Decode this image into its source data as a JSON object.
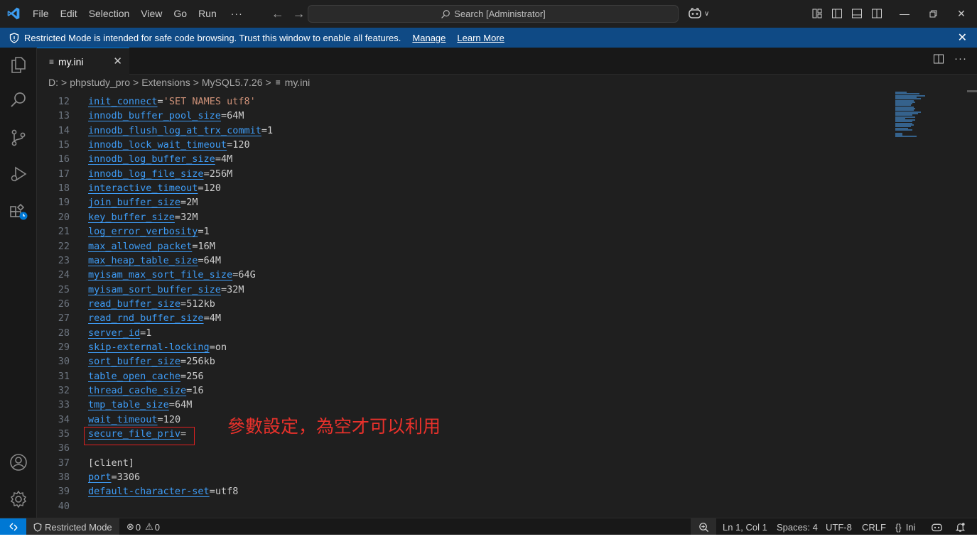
{
  "titlebar": {
    "menu": [
      "File",
      "Edit",
      "Selection",
      "View",
      "Go",
      "Run"
    ],
    "more": "···",
    "search_placeholder": "Search [Administrator]"
  },
  "banner": {
    "message": "Restricted Mode is intended for safe code browsing. Trust this window to enable all features.",
    "manage": "Manage",
    "learn_more": "Learn More",
    "close": "✕"
  },
  "tab": {
    "label": "my.ini",
    "icon": "≡",
    "close": "✕"
  },
  "breadcrumb": {
    "items": [
      "D:",
      "phpstudy_pro",
      "Extensions",
      "MySQL5.7.26",
      "my.ini"
    ],
    "separator": ">",
    "file_icon": "≡"
  },
  "editor": {
    "lines": [
      {
        "n": "12",
        "key": "init_connect",
        "eq": "=",
        "str": "'SET NAMES utf8'"
      },
      {
        "n": "13",
        "key": "innodb_buffer_pool_size",
        "eq": "=",
        "val": "64M"
      },
      {
        "n": "14",
        "key": "innodb_flush_log_at_trx_commit",
        "eq": "=",
        "val": "1"
      },
      {
        "n": "15",
        "key": "innodb_lock_wait_timeout",
        "eq": "=",
        "val": "120"
      },
      {
        "n": "16",
        "key": "innodb_log_buffer_size",
        "eq": "=",
        "val": "4M"
      },
      {
        "n": "17",
        "key": "innodb_log_file_size",
        "eq": "=",
        "val": "256M"
      },
      {
        "n": "18",
        "key": "interactive_timeout",
        "eq": "=",
        "val": "120"
      },
      {
        "n": "19",
        "key": "join_buffer_size",
        "eq": "=",
        "val": "2M"
      },
      {
        "n": "20",
        "key": "key_buffer_size",
        "eq": "=",
        "val": "32M"
      },
      {
        "n": "21",
        "key": "log_error_verbosity",
        "eq": "=",
        "val": "1"
      },
      {
        "n": "22",
        "key": "max_allowed_packet",
        "eq": "=",
        "val": "16M"
      },
      {
        "n": "23",
        "key": "max_heap_table_size",
        "eq": "=",
        "val": "64M"
      },
      {
        "n": "24",
        "key": "myisam_max_sort_file_size",
        "eq": "=",
        "val": "64G"
      },
      {
        "n": "25",
        "key": "myisam_sort_buffer_size",
        "eq": "=",
        "val": "32M"
      },
      {
        "n": "26",
        "key": "read_buffer_size",
        "eq": "=",
        "val": "512kb"
      },
      {
        "n": "27",
        "key": "read_rnd_buffer_size",
        "eq": "=",
        "val": "4M"
      },
      {
        "n": "28",
        "key": "server_id",
        "eq": "=",
        "val": "1"
      },
      {
        "n": "29",
        "key": "skip-external-locking",
        "eq": "=",
        "val": "on"
      },
      {
        "n": "30",
        "key": "sort_buffer_size",
        "eq": "=",
        "val": "256kb"
      },
      {
        "n": "31",
        "key": "table_open_cache",
        "eq": "=",
        "val": "256"
      },
      {
        "n": "32",
        "key": "thread_cache_size",
        "eq": "=",
        "val": "16"
      },
      {
        "n": "33",
        "key": "tmp_table_size",
        "eq": "=",
        "val": "64M"
      },
      {
        "n": "34",
        "key": "wait_timeout",
        "eq": "=",
        "val": "120"
      },
      {
        "n": "35",
        "key": "secure_file_priv",
        "eq": "=",
        "val": ""
      },
      {
        "n": "36"
      },
      {
        "n": "37",
        "section": "[client]"
      },
      {
        "n": "38",
        "key": "port",
        "eq": "=",
        "val": "3306"
      },
      {
        "n": "39",
        "key": "default-character-set",
        "eq": "=",
        "val": "utf8"
      },
      {
        "n": "40"
      }
    ],
    "annotation": "參數設定，為空才可以利用"
  },
  "statusbar": {
    "restricted": "Restricted Mode",
    "errors": "0",
    "warnings": "0",
    "position": "Ln 1, Col 1",
    "spaces": "Spaces: 4",
    "encoding": "UTF-8",
    "eol": "CRLF",
    "language_icon": "{}",
    "language": "Ini"
  },
  "colors": {
    "banner": "#0f4a85",
    "accent": "#0078d4",
    "key": "#3e9cf6",
    "string": "#ce9178",
    "annotation": "#e8312b"
  }
}
